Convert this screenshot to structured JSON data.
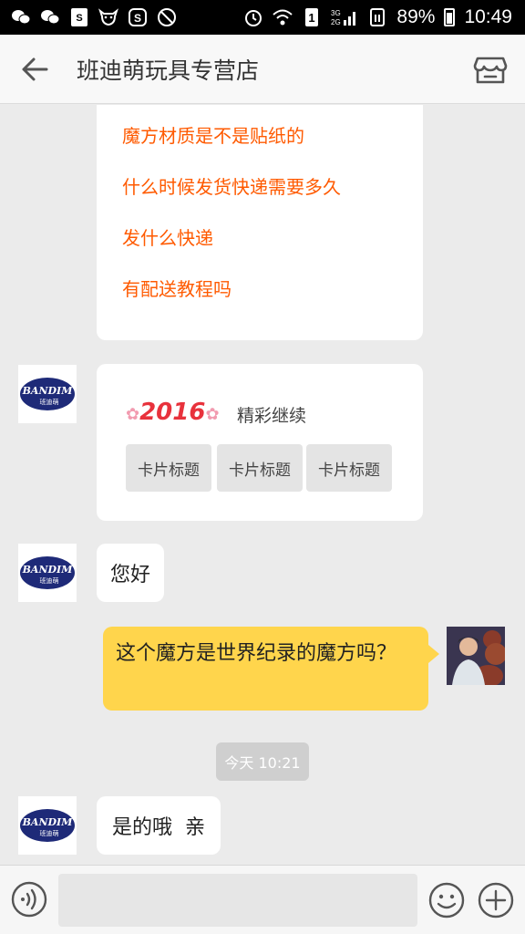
{
  "status_bar": {
    "battery": "89%",
    "time": "10:49",
    "network_label": "3G 2G",
    "sim_label": "1"
  },
  "header": {
    "title": "班迪萌玩具专营店"
  },
  "messages": {
    "faq_items": [
      "魔方材质是不是贴纸的",
      "什么时候发货快递需要多久",
      "发什么快递",
      "有配送教程吗"
    ],
    "card": {
      "year": "2016",
      "subtitle": "精彩继续",
      "tags": [
        "卡片标题",
        "卡片标题",
        "卡片标题"
      ]
    },
    "greeting": "您好",
    "user_message": "这个魔方是世界纪录的魔方吗？",
    "timestamp": "今天 10:21",
    "reply": "是的哦  亲"
  },
  "shop_avatar": {
    "brand": "BANDIM",
    "brand_cn": "班迪萌"
  },
  "input_bar": {
    "placeholder": ""
  },
  "colors": {
    "faq_text": "#ff5a00",
    "user_bubble": "#ffd54c",
    "chat_background": "#ebebeb",
    "year_red": "#e8323c",
    "avatar_navy": "#1e2a78"
  }
}
